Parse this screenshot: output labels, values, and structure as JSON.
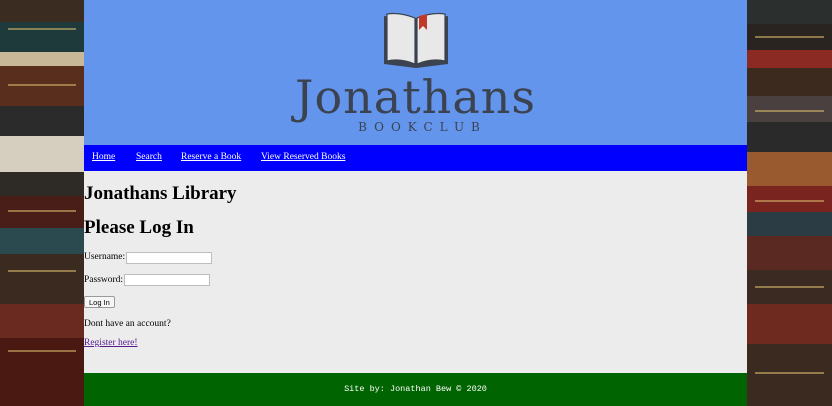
{
  "banner": {
    "logo_title": "Jonathans",
    "logo_subtitle": "BOOKCLUB",
    "background_color": "#6495ed"
  },
  "nav": {
    "background_color": "#0000ff",
    "items": [
      {
        "label": "Home"
      },
      {
        "label": "Search"
      },
      {
        "label": "Reserve a Book"
      },
      {
        "label": "View Reserved Books"
      }
    ]
  },
  "main": {
    "heading": "Jonathans Library",
    "subheading": "Please Log In",
    "username_label": "Username:",
    "username_value": "",
    "password_label": "Password:",
    "password_value": "",
    "login_button": "Log In",
    "no_account_text": "Dont have an account?",
    "register_link": "Register here!"
  },
  "footer": {
    "text": "Site by: Jonathan Bew © 2020",
    "background_color": "#006400"
  },
  "icons": {
    "logo": "open-book-bookmark-icon"
  }
}
